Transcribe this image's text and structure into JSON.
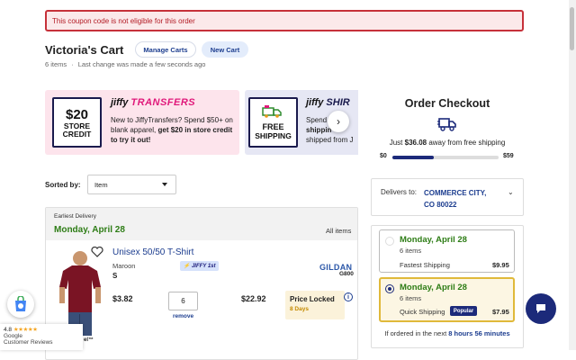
{
  "alert": {
    "message": "This coupon code is not eligible for this order"
  },
  "cart": {
    "title": "Victoria's Cart",
    "manage_label": "Manage Carts",
    "new_label": "New Cart",
    "item_count": "6 items",
    "last_change": "Last change was made a few seconds ago"
  },
  "promos": [
    {
      "box_big": "$20",
      "box_line1": "STORE",
      "box_line2": "CREDIT",
      "brand_prefix": "jiffy",
      "brand_suffix": "TRANSFERS",
      "text_a": "New to JiffyTransfers? Spend $50+ on blank apparel, ",
      "text_b": "get $20 in store credit to try it out!"
    },
    {
      "box_line1": "FREE",
      "box_line2": "SHIPPING",
      "brand_prefix": "jiffy",
      "brand_suffix": "SHIR",
      "text_a": "Spend",
      "text_b": "shippin",
      "text_c": "shipped from J"
    }
  ],
  "sort": {
    "label": "Sorted by:",
    "value": "Item"
  },
  "delivery_group": {
    "earliest_label": "Earliest Delivery",
    "date": "Monday, April 28",
    "all_items": "All items"
  },
  "product": {
    "name": "Unisex 50/50 T-Shirt",
    "color": "Maroon",
    "size": "S",
    "badge": "JIFFY 1st",
    "brand": "GILDAN",
    "brand_code": "G800",
    "unit_price": "$3.82",
    "quantity": "6",
    "remove_label": "remove",
    "line_total": "$22.92",
    "price_locked": "Price Locked",
    "price_locked_days": "8 Days",
    "partial_label": "el™"
  },
  "checkout": {
    "title": "Order Checkout",
    "free_ship_prefix": "Just ",
    "free_ship_amount": "$36.08",
    "free_ship_suffix": " away from free shipping",
    "bar_start": "$0",
    "bar_end": "$59",
    "progress": 0.39,
    "delivers_label": "Delivers to:",
    "delivers_city_line1": "COMMERCE CITY,",
    "delivers_city_line2": "CO 80022",
    "options": [
      {
        "date": "Monday, April 28",
        "count": "6 items",
        "type": "Fastest Shipping",
        "price": "$9.95",
        "selected": false
      },
      {
        "date": "Monday, April 28",
        "count": "6 items",
        "type": "Quick Shipping",
        "badge": "Popular",
        "price": "$7.95",
        "selected": true
      }
    ],
    "order_by_prefix": "If ordered in the next ",
    "order_by_time": "8 hours 56 minutes"
  },
  "reviews": {
    "rating": "4.8",
    "stars": "★★★★★",
    "source": "Google",
    "label": "Customer Reviews"
  },
  "colors": {
    "accent": "#1c2a7a",
    "green": "#2e7d16",
    "link": "#1c3d8f",
    "alert": "#c6313a",
    "promo_pink": "#fde4ec"
  }
}
